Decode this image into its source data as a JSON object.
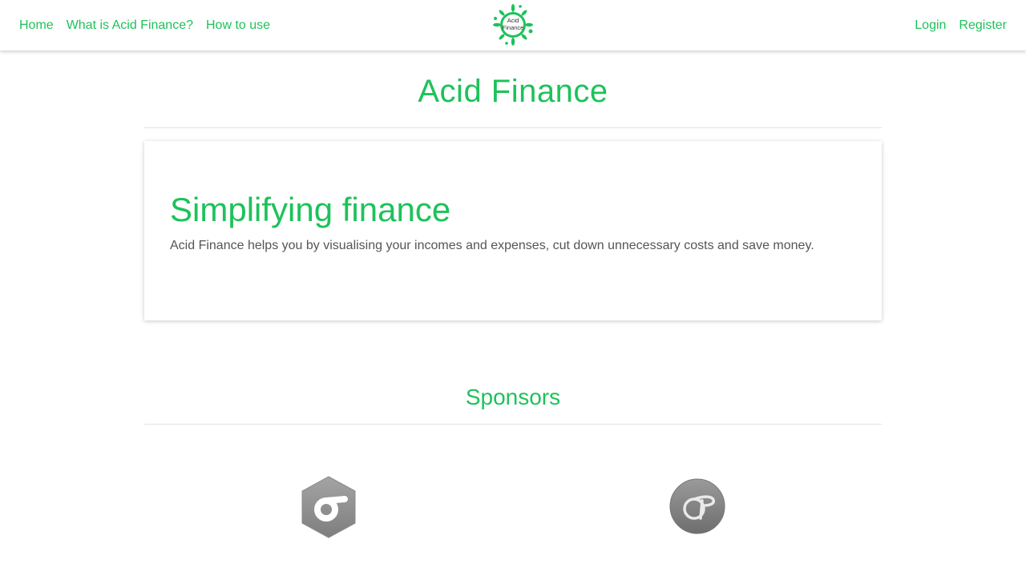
{
  "nav": {
    "left": [
      {
        "label": "Home"
      },
      {
        "label": "What is Acid Finance?"
      },
      {
        "label": "How to use"
      }
    ],
    "right": [
      {
        "label": "Login"
      },
      {
        "label": "Register"
      }
    ],
    "logo": {
      "line1": "Acid",
      "line2": "Finance"
    }
  },
  "page": {
    "title": "Acid Finance"
  },
  "hero": {
    "title": "Simplifying finance",
    "text": "Acid Finance helps you by visualising your incomes and expenses, cut down unnecessary costs and save money."
  },
  "sponsors": {
    "title": "Sponsors",
    "items": [
      {
        "icon": "sigma-hexagon-logo-icon"
      },
      {
        "icon": "sigma-circle-logo-icon"
      }
    ]
  },
  "colors": {
    "accent": "#1dc25a",
    "text": "#555555",
    "sponsor_gray": "#8e8e8e"
  }
}
